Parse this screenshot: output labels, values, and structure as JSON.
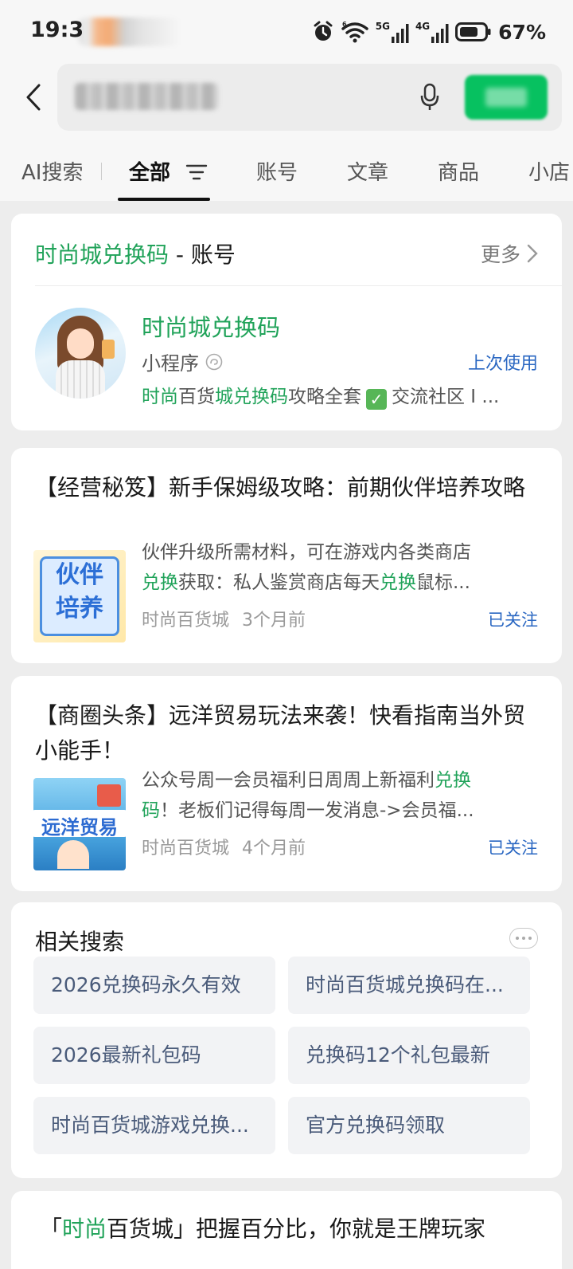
{
  "status_bar": {
    "time": "19:3",
    "battery": "67%",
    "network_5g": "5G",
    "network_4g": "4G"
  },
  "search": {
    "query": "",
    "search_button": ""
  },
  "tabs": [
    "AI搜索",
    "全部",
    "账号",
    "文章",
    "商品",
    "小店"
  ],
  "account_card": {
    "title_highlight": "时尚城兑换码",
    "title_suffix": " - 账号",
    "more": "更多",
    "name": "时尚城兑换码",
    "type": "小程序",
    "last_used": "上次使用",
    "desc_parts": [
      "时尚",
      "百货",
      "城兑换码",
      "攻略全套",
      "交流社区 I ..."
    ]
  },
  "articles": [
    {
      "title": "【经营秘笈】新手保姆级攻略：前期伙伴培养攻略",
      "thumb_text": [
        "伙伴",
        "培养"
      ],
      "desc_line1": "伙伴升级所需材料，可在游戏内各类商店",
      "desc_line2_parts": [
        "兑换",
        "获取：私人鉴赏商店每天",
        "兑换",
        "鼠标..."
      ],
      "source": "时尚百货城",
      "time": "3个月前",
      "follow": "已关注"
    },
    {
      "title": "【商圈头条】远洋贸易玩法来袭！快看指南当外贸小能手！",
      "thumb_text": "远洋贸易",
      "desc_line1_parts": [
        "公众号周一会员福利日周周上新福利",
        "兑换"
      ],
      "desc_line2_parts": [
        "码",
        "！老板们记得每周一发消息->会员福..."
      ],
      "source": "时尚百货城",
      "time": "4个月前",
      "follow": "已关注"
    }
  ],
  "related": {
    "title": "相关搜索",
    "items": [
      "2026兑换码永久有效",
      "时尚百货城兑换码在...",
      "2026最新礼包码",
      "兑换码12个礼包最新",
      "时尚百货城游戏兑换...",
      "官方兑换码领取"
    ]
  },
  "bottom_card": {
    "open_quote": "「",
    "highlight": "时尚",
    "rest": "百货城」把握百分比，你就是王牌玩家"
  },
  "colors": {
    "accent_green": "#21a35a",
    "link_blue": "#2a67c2",
    "wechat_green": "#07c160"
  }
}
